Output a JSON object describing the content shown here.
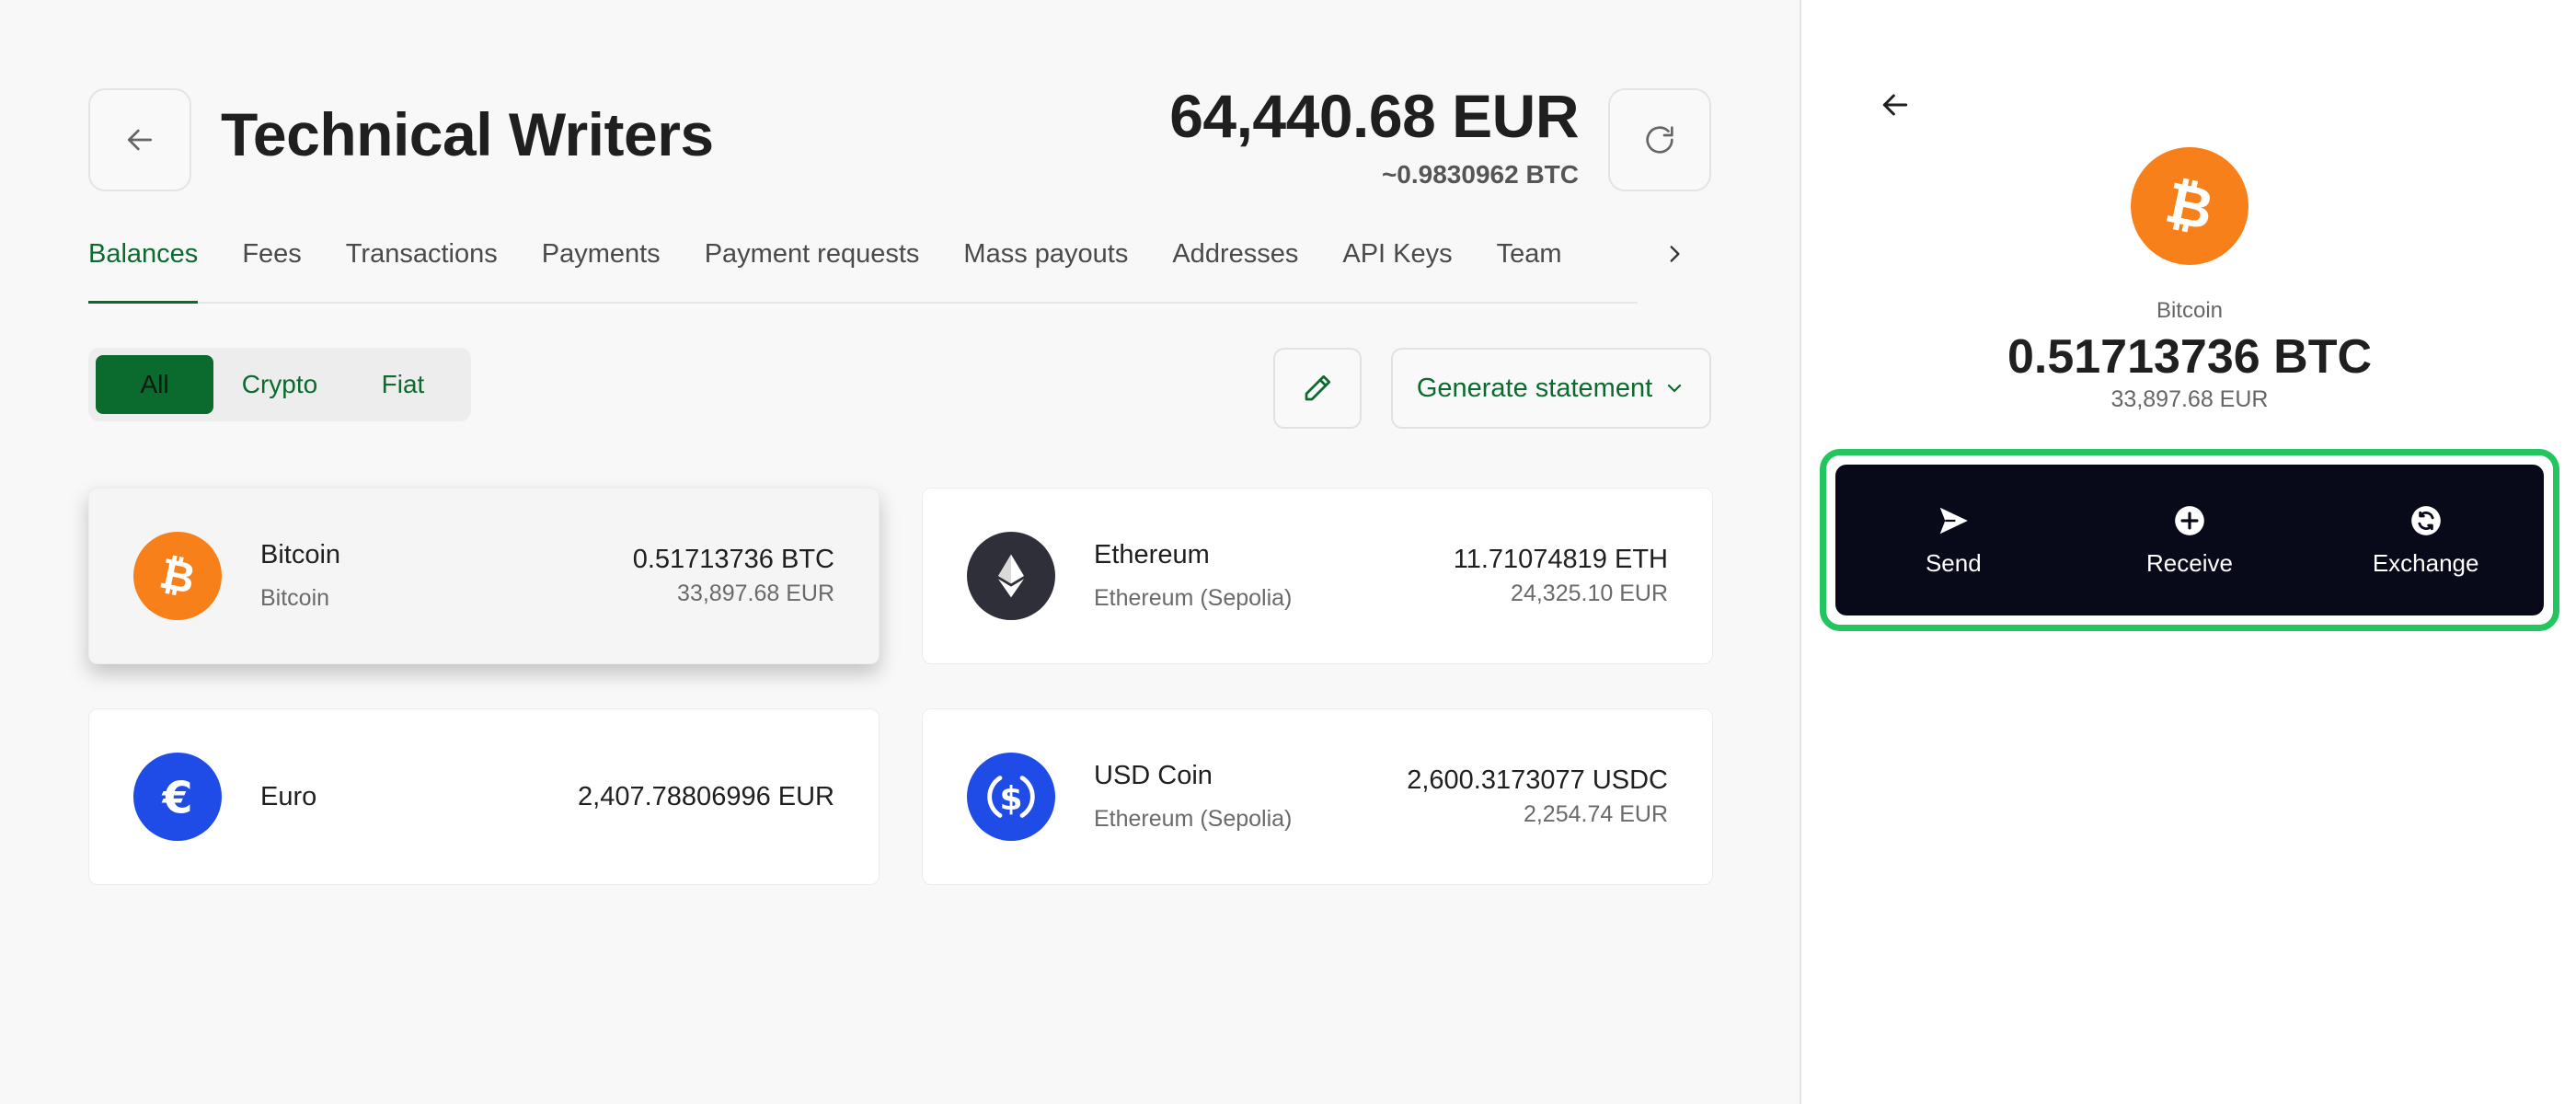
{
  "header": {
    "title": "Technical Writers",
    "total_amount": "64,440.68 EUR",
    "total_btc": "~0.9830962 BTC"
  },
  "tabs": [
    {
      "label": "Balances",
      "active": true
    },
    {
      "label": "Fees"
    },
    {
      "label": "Transactions"
    },
    {
      "label": "Payments"
    },
    {
      "label": "Payment requests"
    },
    {
      "label": "Mass payouts"
    },
    {
      "label": "Addresses"
    },
    {
      "label": "API Keys"
    },
    {
      "label": "Team"
    }
  ],
  "filter": {
    "all": "All",
    "crypto": "Crypto",
    "fiat": "Fiat",
    "selected": "All"
  },
  "toolbar": {
    "statement_label": "Generate statement"
  },
  "balances": [
    {
      "name": "Bitcoin",
      "network": "Bitcoin",
      "amount": "0.51713736 BTC",
      "fiat": "33,897.68 EUR",
      "icon": "bitcoin-icon",
      "color": "#f7801a"
    },
    {
      "name": "Ethereum",
      "network": "Ethereum (Sepolia)",
      "amount": "11.71074819 ETH",
      "fiat": "24,325.10 EUR",
      "icon": "ethereum-icon",
      "color": "#2f2f3a"
    },
    {
      "name": "Euro",
      "network": "",
      "amount": "2,407.78806996 EUR",
      "fiat": "",
      "icon": "euro-icon",
      "color": "#1f4be6"
    },
    {
      "name": "USD Coin",
      "network": "Ethereum (Sepolia)",
      "amount": "2,600.3173077 USDC",
      "fiat": "2,254.74 EUR",
      "icon": "usdc-icon",
      "color": "#1f4be6"
    }
  ],
  "panel": {
    "name": "Bitcoin",
    "amount": "0.51713736 BTC",
    "fiat": "33,897.68 EUR",
    "actions": {
      "send": "Send",
      "receive": "Receive",
      "exchange": "Exchange"
    }
  },
  "colors": {
    "accent": "#0b6b2e",
    "highlight": "#22c55e",
    "action_bar": "#080a1a",
    "bitcoin": "#f7801a",
    "ethereum": "#2f2f3a",
    "blue": "#1f4be6"
  }
}
